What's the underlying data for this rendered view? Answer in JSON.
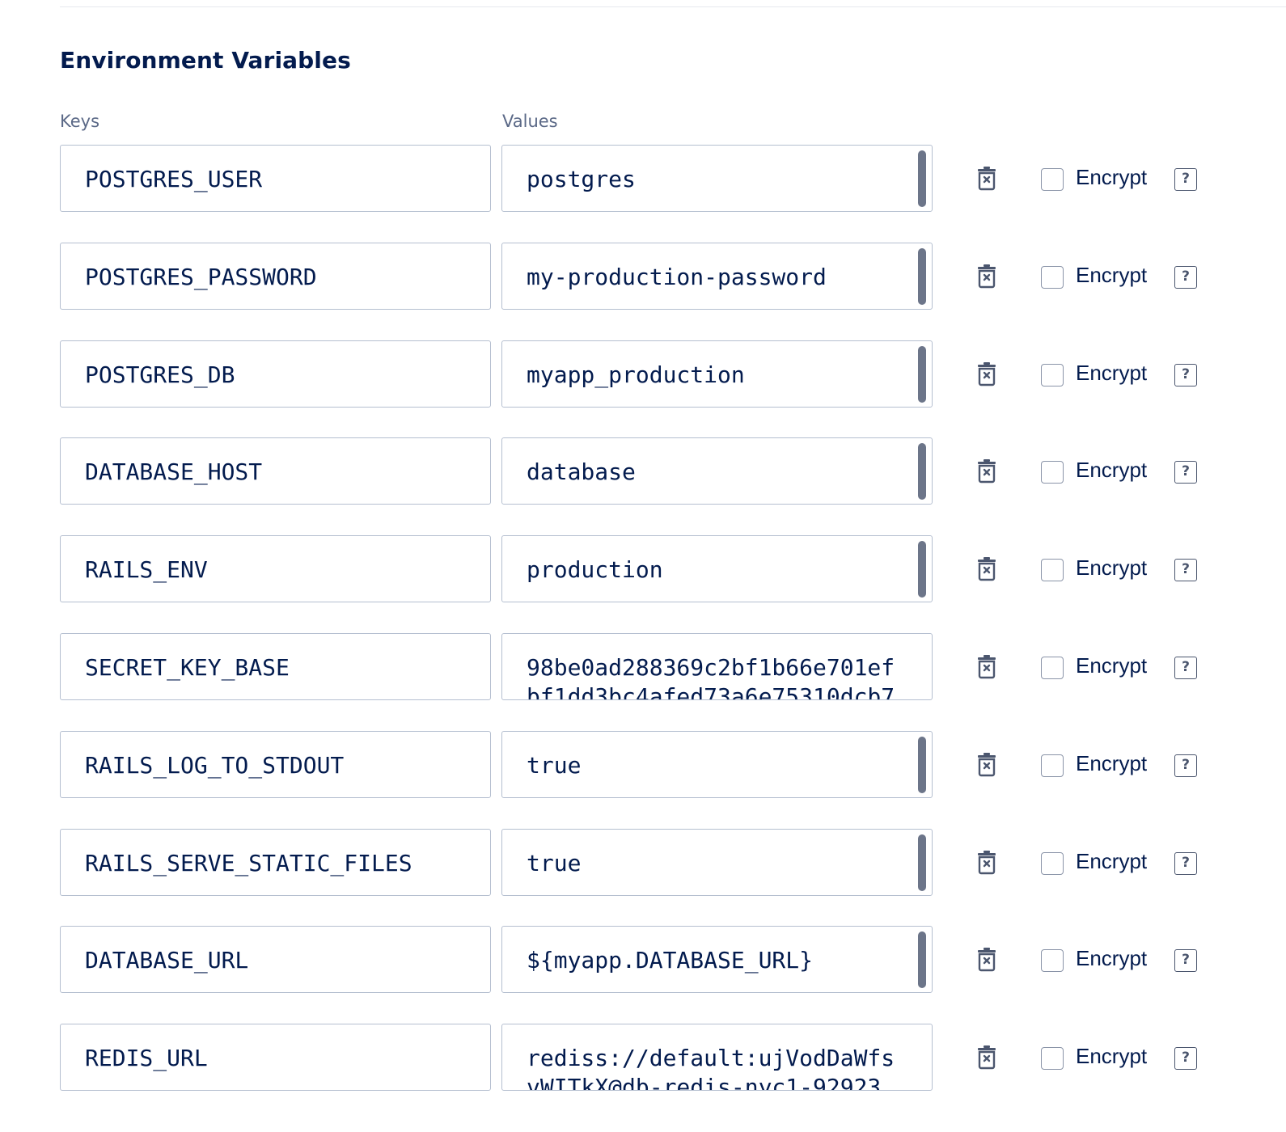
{
  "section": {
    "title": "Environment Variables",
    "keys_label": "Keys",
    "values_label": "Values"
  },
  "encrypt_label": "Encrypt",
  "help_glyph": "?",
  "rows": [
    {
      "key": "POSTGRES_USER",
      "value": "postgres",
      "multiline": false
    },
    {
      "key": "POSTGRES_PASSWORD",
      "value": "my-production-password",
      "multiline": false
    },
    {
      "key": "POSTGRES_DB",
      "value": "myapp_production",
      "multiline": false
    },
    {
      "key": "DATABASE_HOST",
      "value": "database",
      "multiline": false
    },
    {
      "key": "RAILS_ENV",
      "value": "production",
      "multiline": false
    },
    {
      "key": "SECRET_KEY_BASE",
      "value": "98be0ad288369c2bf1b66e701efbf1dd3bc4afed73a6e75310dcb7",
      "multiline": true
    },
    {
      "key": "RAILS_LOG_TO_STDOUT",
      "value": "true",
      "multiline": false
    },
    {
      "key": "RAILS_SERVE_STATIC_FILES",
      "value": "true",
      "multiline": false
    },
    {
      "key": "DATABASE_URL",
      "value": "${myapp.DATABASE_URL}",
      "multiline": false
    },
    {
      "key": "REDIS_URL",
      "value": "rediss://default:ujVodDaWfsvWITkX@db-redis-nyc1-92923",
      "multiline": true
    }
  ],
  "colors": {
    "text": "#031b4e",
    "label": "#5b6987",
    "border": "#b5bfd0",
    "icon": "#4b566e",
    "scrollbar": "#6c7589"
  },
  "icons": {
    "delete": "trash-icon",
    "help": "question-icon"
  }
}
